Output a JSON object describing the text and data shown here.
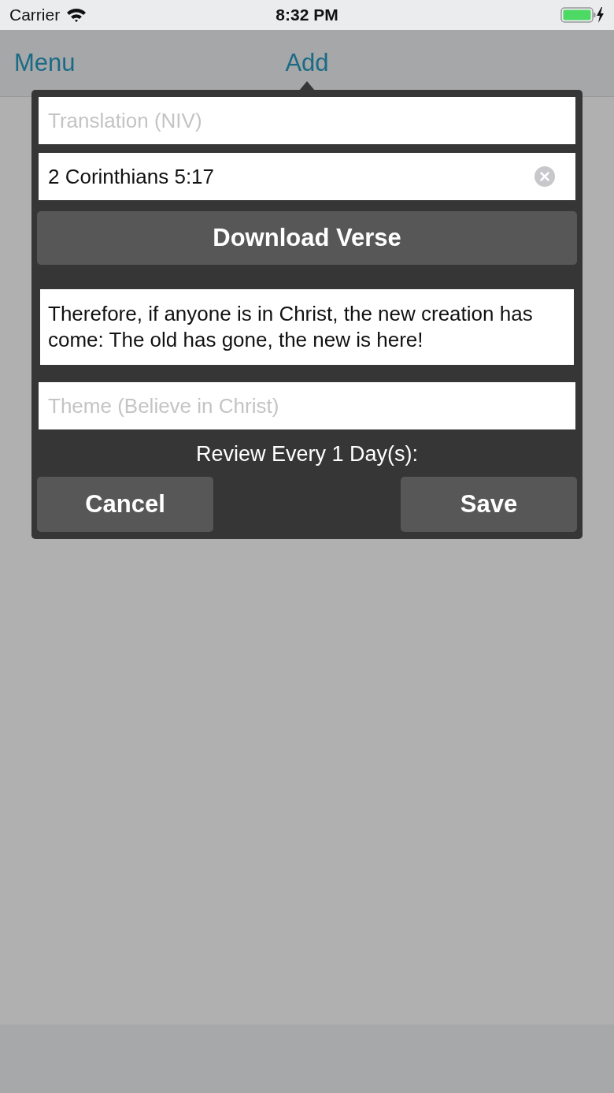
{
  "status_bar": {
    "carrier": "Carrier",
    "time": "8:32 PM"
  },
  "nav_bar": {
    "menu_button": "Menu",
    "title": "Add"
  },
  "popover": {
    "translation_field": {
      "placeholder": "Translation (NIV)"
    },
    "reference_field": {
      "value": "2 Corinthians 5:17"
    },
    "download_button": "Download Verse",
    "verse_text": "Therefore, if anyone is in Christ, the new creation has come: The old has gone, the new is here!",
    "theme_field": {
      "placeholder": "Theme (Believe in Christ)"
    },
    "review_label": "Review Every 1 Day(s):",
    "buttons": [
      {
        "label": "Cancel"
      },
      {
        "label": "Save"
      }
    ]
  }
}
